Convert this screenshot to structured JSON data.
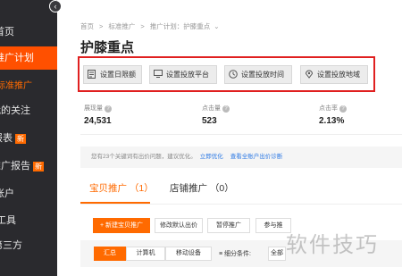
{
  "sidebar": {
    "items": [
      {
        "label": "首页"
      },
      {
        "label": "推广计划"
      },
      {
        "label": "标准推广"
      },
      {
        "label": "我的关注"
      },
      {
        "label": "报表",
        "badge": "新"
      },
      {
        "label": "推广报告",
        "badge": "新"
      },
      {
        "label": "账户"
      },
      {
        "label": "工具"
      },
      {
        "label": "第三方"
      }
    ]
  },
  "breadcrumb": {
    "items": [
      "首页",
      "标准推广",
      "推广计划：护膝重点"
    ]
  },
  "page": {
    "title": "护膝重点"
  },
  "toolbar": {
    "buttons": [
      {
        "label": "设置日限额",
        "icon": "budget-icon"
      },
      {
        "label": "设置投放平台",
        "icon": "platform-icon"
      },
      {
        "label": "设置投放时间",
        "icon": "clock-icon"
      },
      {
        "label": "设置投放地域",
        "icon": "location-icon"
      }
    ]
  },
  "stats": [
    {
      "label": "展现量",
      "value": "24,531"
    },
    {
      "label": "点击量",
      "value": "523"
    },
    {
      "label": "点击率",
      "value": "2.13%"
    }
  ],
  "notice": {
    "text": "您有23个关键词有出价问题，建议优化。",
    "link1": "立即优化",
    "link2": "查看全账户出价诊断"
  },
  "tabs": [
    {
      "label": "宝贝推广 （1）"
    },
    {
      "label": "店铺推广 （0）"
    }
  ],
  "actions": {
    "new_label": "+ 新建宝贝推广",
    "default_bid_label": "修改默认出价",
    "pause_label": "暂停推广",
    "participate_label": "参与推"
  },
  "filter": {
    "segments": [
      "汇总",
      "计算机",
      "移动设备"
    ],
    "filter_label": "细分条件:",
    "filter_value": "全部"
  },
  "watermark": "软件技巧",
  "colors": {
    "accent": "#ff6a00",
    "sidebar_bg": "#2a2a2e",
    "highlight_box": "#e02020",
    "link": "#2b78e4"
  }
}
